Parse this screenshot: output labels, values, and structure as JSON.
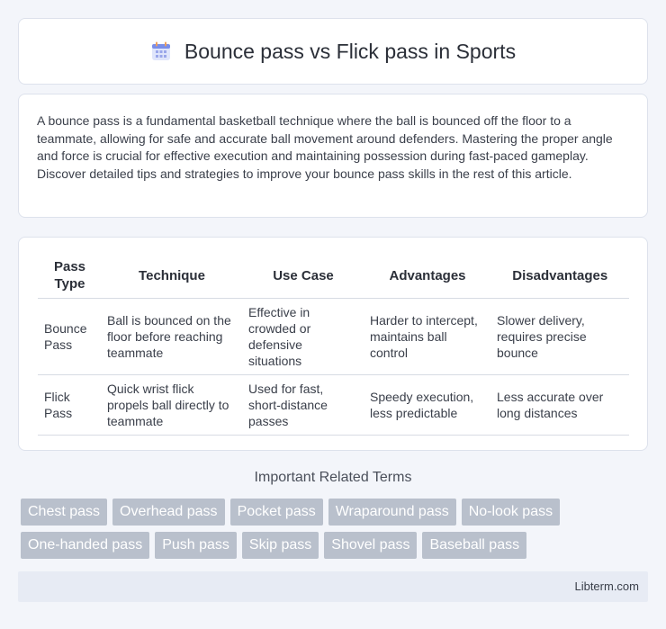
{
  "header": {
    "title": "Bounce pass vs Flick pass in Sports",
    "icon": "calendar-icon"
  },
  "intro": {
    "text": "A bounce pass is a fundamental basketball technique where the ball is bounced off the floor to a teammate, allowing for safe and accurate ball movement around defenders. Mastering the proper angle and force is crucial for effective execution and maintaining possession during fast-paced gameplay. Discover detailed tips and strategies to improve your bounce pass skills in the rest of this article."
  },
  "table": {
    "headers": [
      "Pass Type",
      "Technique",
      "Use Case",
      "Advantages",
      "Disadvantages"
    ],
    "rows": [
      [
        "Bounce Pass",
        "Ball is bounced on the floor before reaching teammate",
        "Effective in crowded or defensive situations",
        "Harder to intercept, maintains ball control",
        "Slower delivery, requires precise bounce"
      ],
      [
        "Flick Pass",
        "Quick wrist flick propels ball directly to teammate",
        "Used for fast, short-distance passes",
        "Speedy execution, less predictable",
        "Less accurate over long distances"
      ]
    ]
  },
  "related": {
    "heading": "Important Related Terms",
    "row1": [
      "Chest pass",
      "Overhead pass",
      "Pocket pass",
      "Wraparound pass",
      "No-look pass"
    ],
    "row2": [
      "One-handed pass",
      "Push pass",
      "Skip pass",
      "Shovel pass",
      "Baseball pass"
    ]
  },
  "footer": {
    "text": "Libterm.com"
  },
  "colors": {
    "tag_bg": "#b9c0cc",
    "footer_bg": "#e7ebf4",
    "icon_accent": "#6b7fe0"
  }
}
